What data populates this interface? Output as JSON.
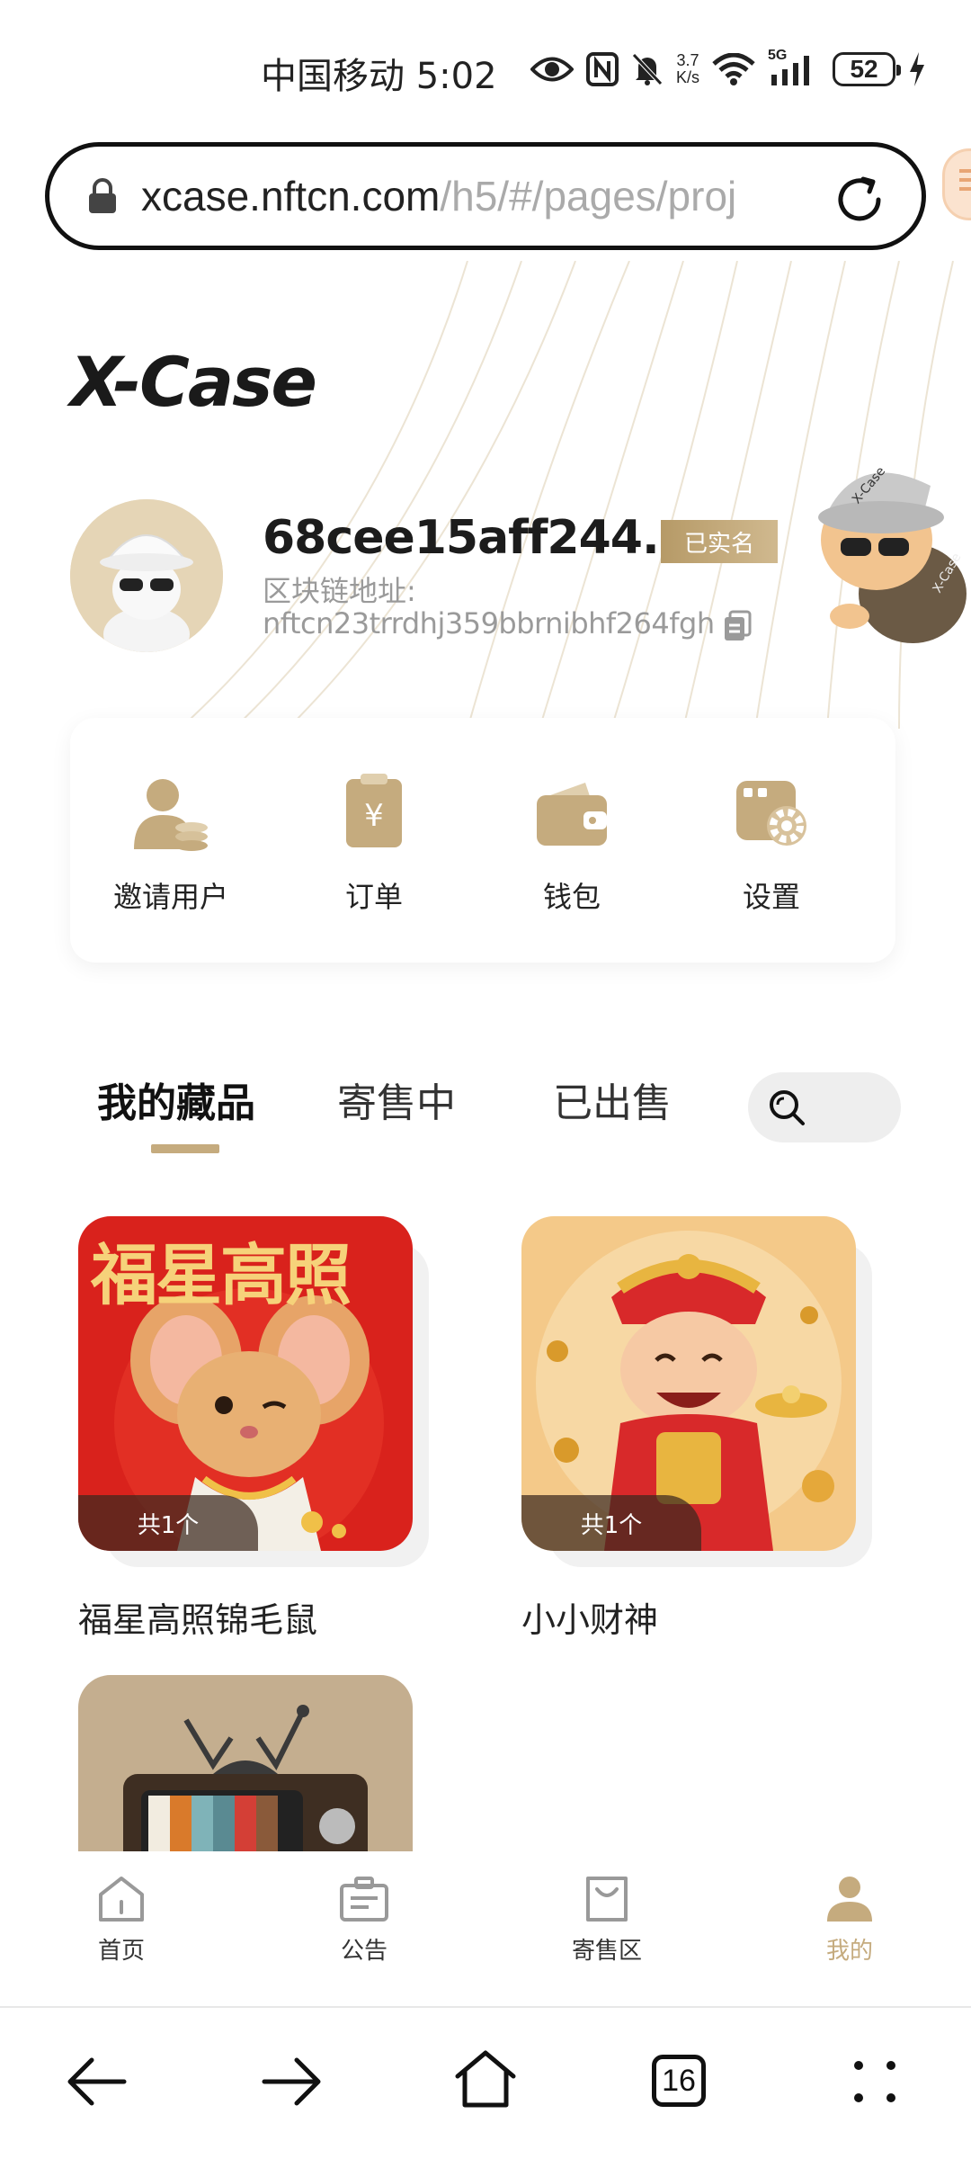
{
  "status_bar": {
    "carrier_time": "中国移动 5:02",
    "net_speed_value": "3.7",
    "net_speed_unit": "K/s",
    "network": "5G",
    "battery": "52"
  },
  "browser": {
    "url_host": "xcase.nftcn.com",
    "url_path": "/h5/#/pages/proj",
    "tab_count": "16"
  },
  "header": {
    "logo": "X-Case"
  },
  "profile": {
    "username": "68cee15aff244...",
    "verified_label": "已实名",
    "chain_label": "区块链地址:",
    "chain_address": "nftcn23trrdhj359bbrnibhf264fgh"
  },
  "actions": [
    {
      "label": "邀请用户",
      "icon": "invite-user-icon"
    },
    {
      "label": "订单",
      "icon": "order-icon"
    },
    {
      "label": "钱包",
      "icon": "wallet-icon"
    },
    {
      "label": "设置",
      "icon": "settings-icon"
    }
  ],
  "tabs": [
    {
      "label": "我的藏品",
      "active": true
    },
    {
      "label": "寄售中",
      "active": false
    },
    {
      "label": "已出售",
      "active": false
    }
  ],
  "collections": [
    {
      "name": "福星高照锦毛鼠",
      "count": "共1个",
      "banner": "福星高照"
    },
    {
      "name": "小小财神",
      "count": "共1个"
    },
    {
      "name": "",
      "count": ""
    }
  ],
  "app_nav": [
    {
      "label": "首页",
      "icon": "home-icon",
      "active": false
    },
    {
      "label": "公告",
      "icon": "announcement-icon",
      "active": false
    },
    {
      "label": "寄售区",
      "icon": "shopping-bag-icon",
      "active": false
    },
    {
      "label": "我的",
      "icon": "profile-icon",
      "active": true
    }
  ],
  "colors": {
    "accent": "#c5ab7e",
    "badge": "#b69a67",
    "red_card": "#d9221c"
  }
}
